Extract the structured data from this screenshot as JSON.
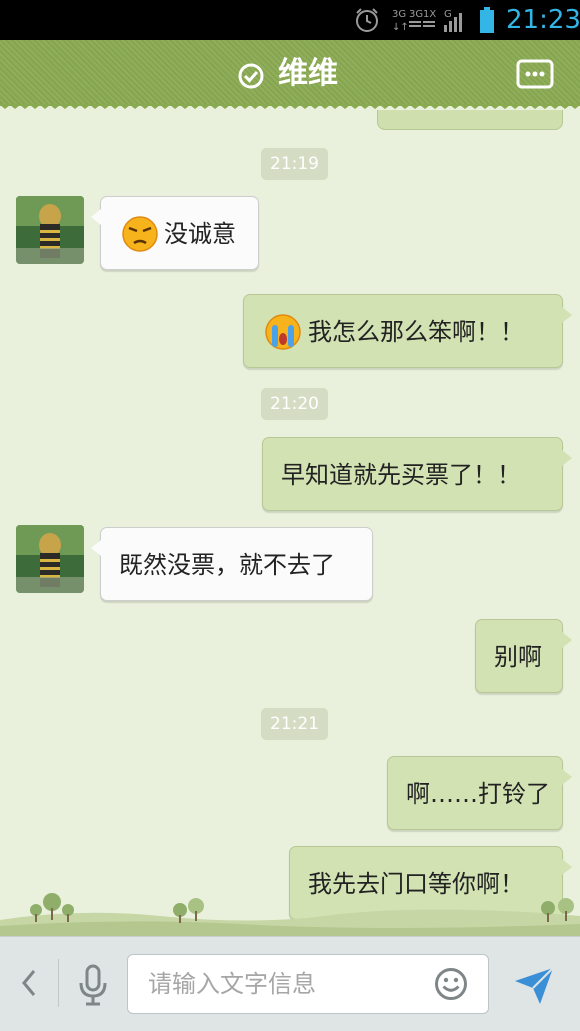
{
  "status_bar": {
    "time": "21:23",
    "icons": [
      "alarm-icon",
      "3g-signal-icon",
      "wifi-icon",
      "cell-signal-icon",
      "battery-icon"
    ]
  },
  "header": {
    "title": "维维",
    "left_icon": "verified-check-icon",
    "right_icon": "more-options-icon",
    "color": "#8aaa52"
  },
  "messages": [
    {
      "type": "time",
      "text": "21:19"
    },
    {
      "type": "msg",
      "side": "left",
      "emoji": "annoyed-face-emoji",
      "text": "没诚意"
    },
    {
      "type": "msg",
      "side": "right",
      "emoji": "crying-face-emoji",
      "text": "我怎么那么笨啊！！"
    },
    {
      "type": "time",
      "text": "21:20"
    },
    {
      "type": "msg",
      "side": "right",
      "text": "早知道就先买票了！！"
    },
    {
      "type": "msg",
      "side": "left",
      "text": "既然没票，就不去了"
    },
    {
      "type": "msg",
      "side": "right",
      "text": "别啊"
    },
    {
      "type": "time",
      "text": "21:21"
    },
    {
      "type": "msg",
      "side": "right",
      "text": "啊……打铃了"
    },
    {
      "type": "msg",
      "side": "right",
      "text": "我先去门口等你啊！"
    }
  ],
  "input": {
    "placeholder": "请输入文字信息",
    "icons": [
      "back-chevron-icon",
      "microphone-icon",
      "smiley-icon",
      "send-icon"
    ]
  },
  "colors": {
    "chat_background": "#e9f1dc",
    "sent_bubble": "#d2e2b3",
    "received_bubble": "#fbfbfb",
    "status_accent": "#33b5e5"
  }
}
